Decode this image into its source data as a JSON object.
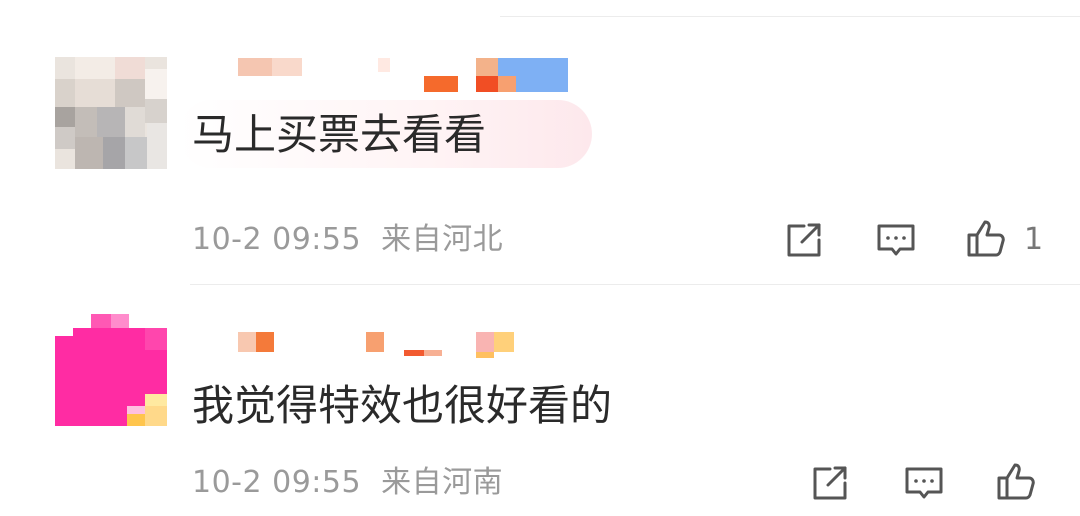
{
  "comments": [
    {
      "text": "马上买票去看看",
      "time": "10-2 09:55",
      "location": "来自河北",
      "likes": "1"
    },
    {
      "text": "我觉得特效也很好看的",
      "time": "10-2 09:55",
      "location": "来自河南",
      "likes": ""
    }
  ],
  "icons": {
    "share": "share-icon",
    "reply": "comment-icon",
    "like": "thumbs-up-icon"
  },
  "colors": {
    "text": "#2a2a2a",
    "meta": "#9a9a9a",
    "icon": "#555555",
    "avatar2": "#ff2ca3"
  }
}
